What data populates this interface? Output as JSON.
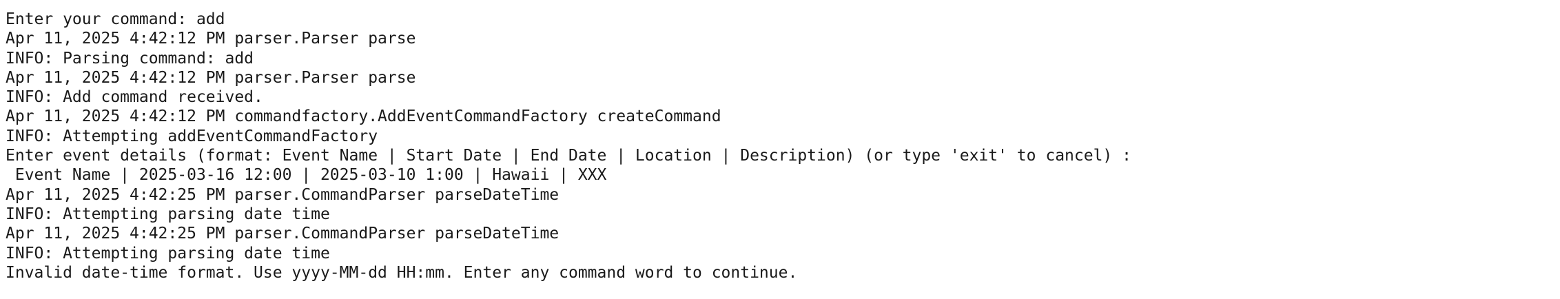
{
  "terminal": {
    "lines": [
      "Enter your command: add",
      "Apr 11, 2025 4:42:12 PM parser.Parser parse",
      "INFO: Parsing command: add",
      "Apr 11, 2025 4:42:12 PM parser.Parser parse",
      "INFO: Add command received.",
      "Apr 11, 2025 4:42:12 PM commandfactory.AddEventCommandFactory createCommand",
      "INFO: Attempting addEventCommandFactory",
      "Enter event details (format: Event Name | Start Date | End Date | Location | Description) (or type 'exit' to cancel) :",
      " Event Name | 2025-03-16 12:00 | 2025-03-10 1:00 | Hawaii | XXX",
      "Apr 11, 2025 4:42:25 PM parser.CommandParser parseDateTime",
      "INFO: Attempting parsing date time",
      "Apr 11, 2025 4:42:25 PM parser.CommandParser parseDateTime",
      "INFO: Attempting parsing date time",
      "Invalid date-time format. Use yyyy-MM-dd HH:mm. Enter any command word to continue."
    ]
  }
}
